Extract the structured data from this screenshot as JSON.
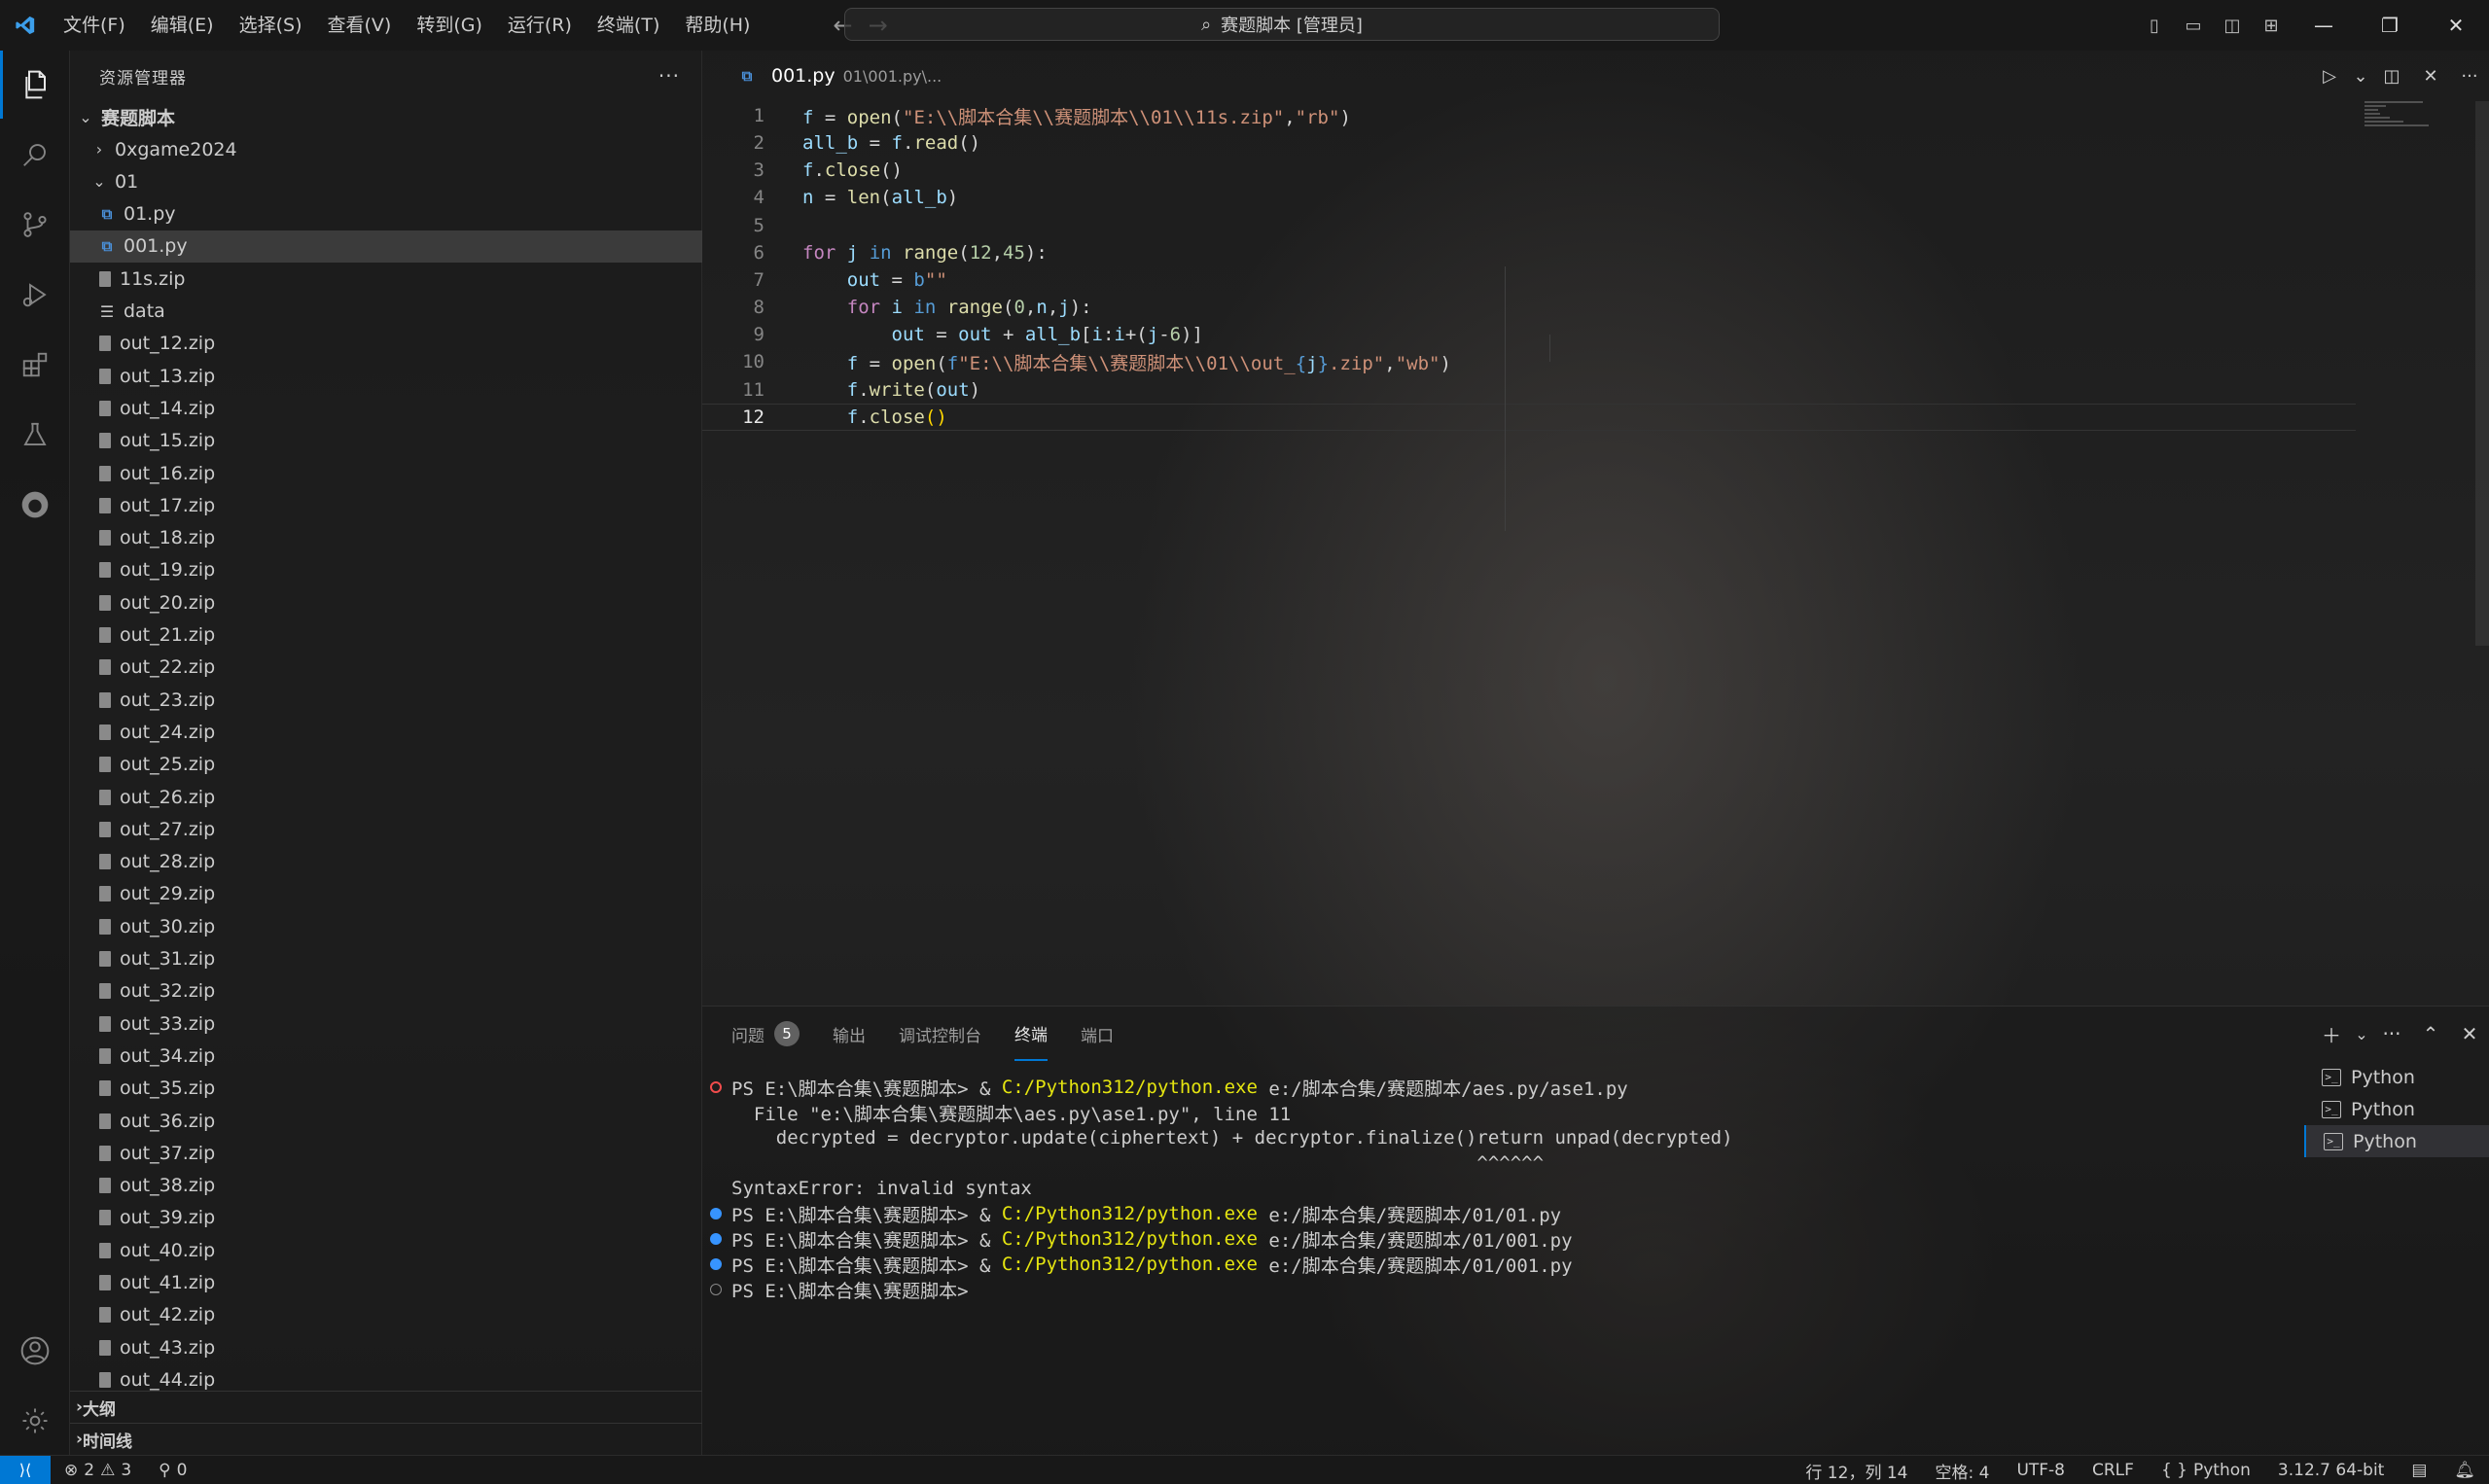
{
  "titlebar": {
    "menus": [
      "文件(F)",
      "编辑(E)",
      "选择(S)",
      "查看(V)",
      "转到(G)",
      "运行(R)",
      "终端(T)",
      "帮助(H)"
    ],
    "search_text": "赛题脚本 [管理员]"
  },
  "sidebar": {
    "title": "资源管理器",
    "root_folder": "赛题脚本",
    "items": [
      {
        "label": "0xgame2024",
        "kind": "folder-collapsed",
        "indent": 1
      },
      {
        "label": "01",
        "kind": "folder-open",
        "indent": 1
      },
      {
        "label": "01.py",
        "kind": "py",
        "indent": 2
      },
      {
        "label": "001.py",
        "kind": "py",
        "indent": 2,
        "selected": true
      },
      {
        "label": "11s.zip",
        "kind": "zip",
        "indent": 2
      },
      {
        "label": "data",
        "kind": "data",
        "indent": 2
      },
      {
        "label": "out_12.zip",
        "kind": "zip",
        "indent": 2
      },
      {
        "label": "out_13.zip",
        "kind": "zip",
        "indent": 2
      },
      {
        "label": "out_14.zip",
        "kind": "zip",
        "indent": 2
      },
      {
        "label": "out_15.zip",
        "kind": "zip",
        "indent": 2
      },
      {
        "label": "out_16.zip",
        "kind": "zip",
        "indent": 2
      },
      {
        "label": "out_17.zip",
        "kind": "zip",
        "indent": 2
      },
      {
        "label": "out_18.zip",
        "kind": "zip",
        "indent": 2
      },
      {
        "label": "out_19.zip",
        "kind": "zip",
        "indent": 2
      },
      {
        "label": "out_20.zip",
        "kind": "zip",
        "indent": 2
      },
      {
        "label": "out_21.zip",
        "kind": "zip",
        "indent": 2
      },
      {
        "label": "out_22.zip",
        "kind": "zip",
        "indent": 2
      },
      {
        "label": "out_23.zip",
        "kind": "zip",
        "indent": 2
      },
      {
        "label": "out_24.zip",
        "kind": "zip",
        "indent": 2
      },
      {
        "label": "out_25.zip",
        "kind": "zip",
        "indent": 2
      },
      {
        "label": "out_26.zip",
        "kind": "zip",
        "indent": 2
      },
      {
        "label": "out_27.zip",
        "kind": "zip",
        "indent": 2
      },
      {
        "label": "out_28.zip",
        "kind": "zip",
        "indent": 2
      },
      {
        "label": "out_29.zip",
        "kind": "zip",
        "indent": 2
      },
      {
        "label": "out_30.zip",
        "kind": "zip",
        "indent": 2
      },
      {
        "label": "out_31.zip",
        "kind": "zip",
        "indent": 2
      },
      {
        "label": "out_32.zip",
        "kind": "zip",
        "indent": 2
      },
      {
        "label": "out_33.zip",
        "kind": "zip",
        "indent": 2
      },
      {
        "label": "out_34.zip",
        "kind": "zip",
        "indent": 2
      },
      {
        "label": "out_35.zip",
        "kind": "zip",
        "indent": 2
      },
      {
        "label": "out_36.zip",
        "kind": "zip",
        "indent": 2
      },
      {
        "label": "out_37.zip",
        "kind": "zip",
        "indent": 2
      },
      {
        "label": "out_38.zip",
        "kind": "zip",
        "indent": 2
      },
      {
        "label": "out_39.zip",
        "kind": "zip",
        "indent": 2
      },
      {
        "label": "out_40.zip",
        "kind": "zip",
        "indent": 2
      },
      {
        "label": "out_41.zip",
        "kind": "zip",
        "indent": 2
      },
      {
        "label": "out_42.zip",
        "kind": "zip",
        "indent": 2
      },
      {
        "label": "out_43.zip",
        "kind": "zip",
        "indent": 2
      },
      {
        "label": "out_44.zip",
        "kind": "zip",
        "indent": 2
      }
    ],
    "outline_label": "大纲",
    "timeline_label": "时间线"
  },
  "editor": {
    "tab_name": "001.py",
    "tab_desc": "01\\001.py\\...",
    "current_line": 12,
    "lines": [
      [
        [
          "v",
          "f"
        ],
        [
          "t",
          " = "
        ],
        [
          "fn",
          "open"
        ],
        [
          "t",
          "("
        ],
        [
          "s",
          "\"E:\\\\脚本合集\\\\赛题脚本\\\\01\\\\11s.zip\""
        ],
        [
          "t",
          ","
        ],
        [
          "s",
          "\"rb\""
        ],
        [
          "t",
          ")"
        ]
      ],
      [
        [
          "v",
          "all_b"
        ],
        [
          "t",
          " = "
        ],
        [
          "v",
          "f"
        ],
        [
          "t",
          "."
        ],
        [
          "fn",
          "read"
        ],
        [
          "t",
          "()"
        ]
      ],
      [
        [
          "v",
          "f"
        ],
        [
          "t",
          "."
        ],
        [
          "fn",
          "close"
        ],
        [
          "t",
          "()"
        ]
      ],
      [
        [
          "v",
          "n"
        ],
        [
          "t",
          " = "
        ],
        [
          "fn",
          "len"
        ],
        [
          "t",
          "("
        ],
        [
          "v",
          "all_b"
        ],
        [
          "t",
          ")"
        ]
      ],
      [],
      [
        [
          "kc",
          "for"
        ],
        [
          "t",
          " "
        ],
        [
          "v",
          "j"
        ],
        [
          "t",
          " "
        ],
        [
          "k",
          "in"
        ],
        [
          "t",
          " "
        ],
        [
          "fn",
          "range"
        ],
        [
          "t",
          "("
        ],
        [
          "n",
          "12"
        ],
        [
          "t",
          ","
        ],
        [
          "n",
          "45"
        ],
        [
          "t",
          "):"
        ]
      ],
      [
        [
          "t",
          "    "
        ],
        [
          "v",
          "out"
        ],
        [
          "t",
          " = "
        ],
        [
          "k",
          "b"
        ],
        [
          "s",
          "\"\""
        ]
      ],
      [
        [
          "t",
          "    "
        ],
        [
          "kc",
          "for"
        ],
        [
          "t",
          " "
        ],
        [
          "v",
          "i"
        ],
        [
          "t",
          " "
        ],
        [
          "k",
          "in"
        ],
        [
          "t",
          " "
        ],
        [
          "fn",
          "range"
        ],
        [
          "t",
          "("
        ],
        [
          "n",
          "0"
        ],
        [
          "t",
          ","
        ],
        [
          "v",
          "n"
        ],
        [
          "t",
          ","
        ],
        [
          "v",
          "j"
        ],
        [
          "t",
          "):"
        ]
      ],
      [
        [
          "t",
          "        "
        ],
        [
          "v",
          "out"
        ],
        [
          "t",
          " = "
        ],
        [
          "v",
          "out"
        ],
        [
          "t",
          " + "
        ],
        [
          "v",
          "all_b"
        ],
        [
          "t",
          "["
        ],
        [
          "v",
          "i"
        ],
        [
          "t",
          ":"
        ],
        [
          "v",
          "i"
        ],
        [
          "t",
          "+("
        ],
        [
          "v",
          "j"
        ],
        [
          "t",
          "-"
        ],
        [
          "n",
          "6"
        ],
        [
          "t",
          ")]"
        ]
      ],
      [
        [
          "t",
          "    "
        ],
        [
          "v",
          "f"
        ],
        [
          "t",
          " = "
        ],
        [
          "fn",
          "open"
        ],
        [
          "t",
          "("
        ],
        [
          "k",
          "f"
        ],
        [
          "s",
          "\"E:\\\\脚本合集\\\\赛题脚本\\\\01\\\\out_"
        ],
        [
          "k",
          "{"
        ],
        [
          "v",
          "j"
        ],
        [
          "k",
          "}"
        ],
        [
          "s",
          ".zip\""
        ],
        [
          "t",
          ","
        ],
        [
          "s",
          "\"wb\""
        ],
        [
          "t",
          ")"
        ]
      ],
      [
        [
          "t",
          "    "
        ],
        [
          "v",
          "f"
        ],
        [
          "t",
          "."
        ],
        [
          "fn",
          "write"
        ],
        [
          "t",
          "("
        ],
        [
          "v",
          "out"
        ],
        [
          "t",
          ")"
        ]
      ],
      [
        [
          "t",
          "    "
        ],
        [
          "v",
          "f"
        ],
        [
          "t",
          "."
        ],
        [
          "fn",
          "close"
        ],
        [
          "p",
          "()"
        ]
      ]
    ]
  },
  "panel": {
    "tabs": [
      {
        "label": "问题",
        "badge": "5"
      },
      {
        "label": "输出"
      },
      {
        "label": "调试控制台"
      },
      {
        "label": "终端",
        "active": true
      },
      {
        "label": "端口"
      }
    ],
    "terminal_lines": [
      {
        "dot": "err",
        "parts": [
          [
            "t",
            "PS E:\\脚本合集\\赛题脚本> & "
          ],
          [
            "y",
            "C:/Python312/python.exe"
          ],
          [
            "t",
            " e:/脚本合集/赛题脚本/aes.py/ase1.py"
          ]
        ]
      },
      {
        "dot": "",
        "parts": [
          [
            "t",
            "  File \"e:\\脚本合集\\赛题脚本\\aes.py\\ase1.py\", line 11"
          ]
        ]
      },
      {
        "dot": "",
        "parts": [
          [
            "t",
            "    decrypted = decryptor.update(ciphertext) + decryptor.finalize()return unpad(decrypted)"
          ]
        ]
      },
      {
        "dot": "",
        "parts": [
          [
            "t",
            "                                                                   ^^^^^^"
          ]
        ]
      },
      {
        "dot": "",
        "parts": [
          [
            "t",
            "SyntaxError: invalid syntax"
          ]
        ]
      },
      {
        "dot": "ok",
        "parts": [
          [
            "t",
            "PS E:\\脚本合集\\赛题脚本> & "
          ],
          [
            "y",
            "C:/Python312/python.exe"
          ],
          [
            "t",
            " e:/脚本合集/赛题脚本/01/01.py"
          ]
        ]
      },
      {
        "dot": "ok",
        "parts": [
          [
            "t",
            "PS E:\\脚本合集\\赛题脚本> & "
          ],
          [
            "y",
            "C:/Python312/python.exe"
          ],
          [
            "t",
            " e:/脚本合集/赛题脚本/01/001.py"
          ]
        ]
      },
      {
        "dot": "ok",
        "parts": [
          [
            "t",
            "PS E:\\脚本合集\\赛题脚本> & "
          ],
          [
            "y",
            "C:/Python312/python.exe"
          ],
          [
            "t",
            " e:/脚本合集/赛题脚本/01/001.py"
          ]
        ]
      },
      {
        "dot": "empty",
        "parts": [
          [
            "t",
            "PS E:\\脚本合集\\赛题脚本> "
          ]
        ]
      }
    ],
    "terminals": [
      "Python",
      "Python",
      "Python"
    ]
  },
  "statusbar": {
    "errors": "2",
    "warnings": "3",
    "ports": "0",
    "position": "行 12，列 14",
    "spaces": "空格: 4",
    "encoding": "UTF-8",
    "eol": "CRLF",
    "language": "Python",
    "interpreter": "3.12.7 64-bit"
  }
}
